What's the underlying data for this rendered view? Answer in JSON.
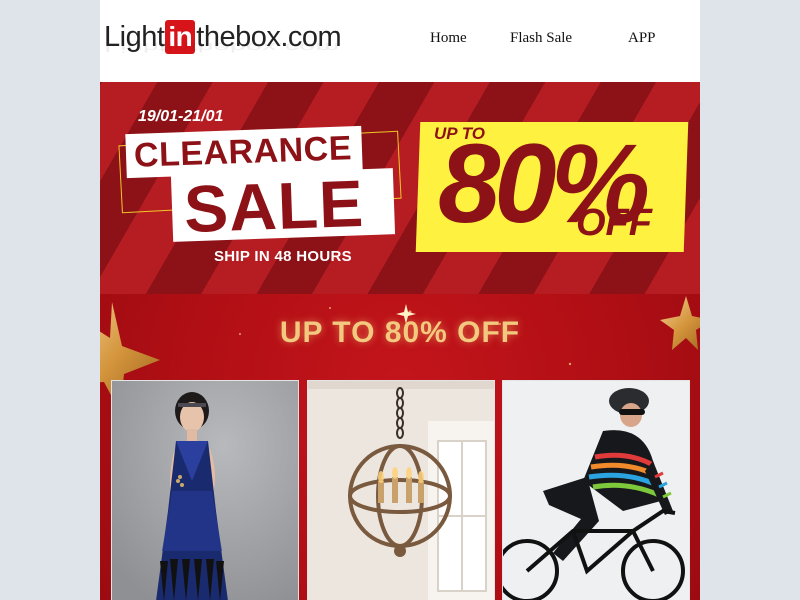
{
  "header": {
    "logo": {
      "part1": "Light",
      "part2": "in",
      "part3": "thebox.com"
    },
    "nav": [
      {
        "label": "Home"
      },
      {
        "label": "Flash Sale"
      },
      {
        "label": "APP"
      }
    ]
  },
  "hero": {
    "date_range": "19/01-21/01",
    "title_line1": "CLEARANCE",
    "title_line2": "SALE",
    "shipping": "SHIP IN 48 HOURS",
    "offer": {
      "prefix": "UP TO",
      "value": "80%",
      "suffix": "OFF"
    },
    "colors": {
      "dark_red": "#8c1217",
      "red": "#b61d22",
      "yellow": "#fff13f"
    }
  },
  "promo": {
    "title": "UP TO 80% OFF",
    "products": [
      {
        "image": "art-deco-sequin-dress-photo"
      },
      {
        "image": "orb-pendant-chandelier-photo"
      },
      {
        "image": "cycling-jersey-photo"
      }
    ]
  }
}
